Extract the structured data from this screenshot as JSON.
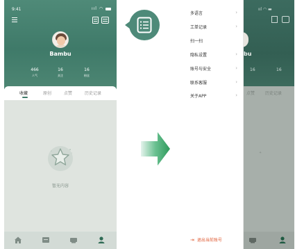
{
  "status": {
    "time": "9:41"
  },
  "profile": {
    "name": "Bambu",
    "stats": [
      {
        "value": "466",
        "label": "人气"
      },
      {
        "value": "16",
        "label": "关注"
      },
      {
        "value": "16",
        "label": "粉丝"
      }
    ]
  },
  "tabs": [
    "收藏",
    "原创",
    "点赞",
    "历史记录"
  ],
  "empty_state": {
    "text": "暂无内容"
  },
  "bottom_nav": [
    "home-icon",
    "store-icon",
    "tray-icon",
    "profile-icon"
  ],
  "drawer": {
    "items": [
      {
        "label": "多语言",
        "chevron": "›"
      },
      {
        "label": "工单记录",
        "chevron": "›"
      },
      {
        "label": "扫一扫",
        "chevron": ""
      },
      {
        "label": "隐私设置",
        "chevron": "›"
      },
      {
        "label": "账号与安全",
        "chevron": "›"
      },
      {
        "label": "联系客服",
        "chevron": "›"
      },
      {
        "label": "关于APP",
        "chevron": "›"
      }
    ],
    "logout": "退出当前账号"
  },
  "right_ghost": {
    "name_fragment": "bu",
    "stats": [
      "16",
      "16"
    ],
    "tabs": [
      "点赞",
      "历史记录"
    ]
  },
  "colors": {
    "accent": "#4e8a79",
    "logout": "#e0603a"
  }
}
